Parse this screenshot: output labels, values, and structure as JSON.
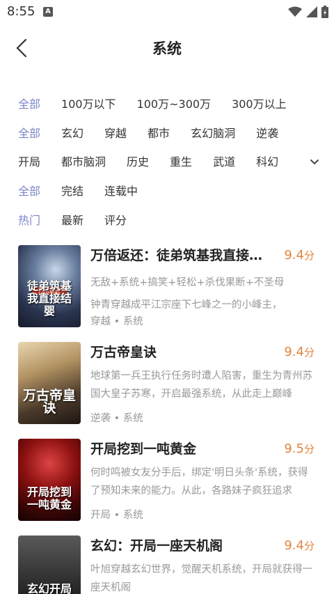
{
  "status": {
    "time": "8:55",
    "notif_letter": "A"
  },
  "header": {
    "title": "系统",
    "back_icon": "back-arrow-icon"
  },
  "filters": {
    "words": [
      "全部",
      "100万以下",
      "100万~300万",
      "300万以上"
    ],
    "genre": [
      "全部",
      "玄幻",
      "穿越",
      "都市",
      "玄幻脑洞",
      "逆袭"
    ],
    "genre2": [
      "开局",
      "都市脑洞",
      "历史",
      "重生",
      "武道",
      "科幻"
    ],
    "status": [
      "全部",
      "完结",
      "连载中"
    ],
    "sort": [
      "热门",
      "最新",
      "评分"
    ],
    "accent_color": "#7b86c9"
  },
  "books": [
    {
      "title": "万倍返还：徒弟筑基我直接结婴",
      "score": "9.4",
      "score_unit": "分",
      "tags": "无敌+系统+搞笑+轻松+杀伐果断+不圣母",
      "desc": "钟青穿越成平江宗座下七峰之一的小峰主，",
      "category": "穿越 • 系统",
      "cover_text": "徒弟筑基我直接结婴",
      "cover_badge": "万倍返还"
    },
    {
      "title": "万古帝皇诀",
      "score": "9.4",
      "score_unit": "分",
      "desc": "地球第一兵王执行任务时遭人陷害，重生为青州苏国大皇子苏寒，开启最强系统，从此走上巅峰",
      "category": "逆袭 • 系统",
      "cover_text": "万古帝皇诀"
    },
    {
      "title": "开局挖到一吨黄金",
      "score": "9.5",
      "score_unit": "分",
      "desc": "何时鸣被女友分手后，绑定'明日头条'系统，获得了预知未来的能力。从此，各路妹子疯狂追求",
      "category": "开局 • 系统",
      "cover_text": "开局挖到一吨黄金"
    },
    {
      "title": "玄幻：开局一座天机阁",
      "score": "9.4",
      "score_unit": "分",
      "desc": "叶旭穿越玄幻世界，觉醒天机系统，开局就获得一座天机阁",
      "category": "",
      "cover_text": "玄幻开局一座天机阁"
    }
  ]
}
